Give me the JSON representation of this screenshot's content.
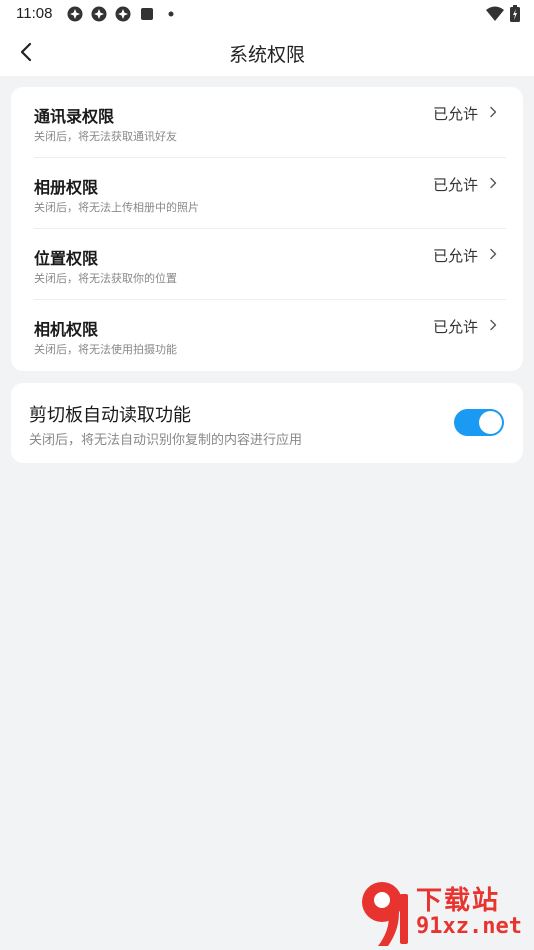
{
  "status_bar": {
    "time": "11:08",
    "left_icons": [
      "app-notification-icon",
      "app-notification-icon",
      "app-notification-icon",
      "square-notification-icon",
      "dot-icon"
    ],
    "right_icons": [
      "wifi-icon",
      "battery-charging-icon"
    ]
  },
  "nav": {
    "title": "系统权限",
    "back_icon": "back-arrow-icon"
  },
  "permissions": [
    {
      "title": "通讯录权限",
      "desc": "关闭后，将无法获取通讯好友",
      "status": "已允许"
    },
    {
      "title": "相册权限",
      "desc": "关闭后，将无法上传相册中的照片",
      "status": "已允许"
    },
    {
      "title": "位置权限",
      "desc": "关闭后，将无法获取你的位置",
      "status": "已允许"
    },
    {
      "title": "相机权限",
      "desc": "关闭后，将无法使用拍摄功能",
      "status": "已允许"
    }
  ],
  "clipboard": {
    "title": "剪切板自动读取功能",
    "desc": "关闭后，将无法自动识别你复制的内容进行应用",
    "enabled": true
  },
  "watermark": {
    "line1": "下载站",
    "line2": "91xz.net"
  },
  "colors": {
    "accent": "#1a9af2",
    "background": "#f2f3f5",
    "watermark": "#e8342f"
  }
}
